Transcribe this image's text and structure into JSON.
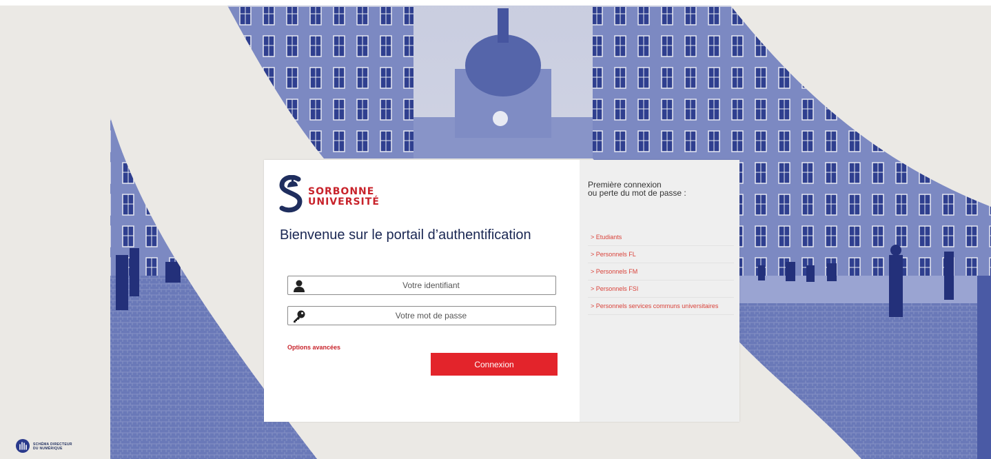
{
  "brand": {
    "line1": "SORBONNE",
    "line2": "UNIVERSITÉ"
  },
  "title": "Bienvenue sur le portail d’authentification",
  "form": {
    "username_placeholder": "Votre identifiant",
    "password_placeholder": "Votre mot de passe",
    "advanced_options": "Options avancées",
    "submit_label": "Connexion"
  },
  "sidebar": {
    "title_line1": "Première connexion",
    "title_line2": "ou perte du mot de passe :",
    "links": [
      {
        "label": "> Etudiants"
      },
      {
        "label": "> Personnels FL"
      },
      {
        "label": "> Personnels FM"
      },
      {
        "label": "> Personnels FSI"
      },
      {
        "label": "> Personnels services communs universitaires"
      }
    ]
  },
  "footer_logo": {
    "line1": "SCHÉMA DIRECTEUR",
    "line2": "DU NUMÉRIQUE"
  },
  "colors": {
    "accent": "#e3242b",
    "link": "#d9423a",
    "navy": "#1a2753",
    "photo_tint": "#3d4f9e"
  },
  "icons": {
    "user": "user-icon",
    "password": "key-icon"
  }
}
